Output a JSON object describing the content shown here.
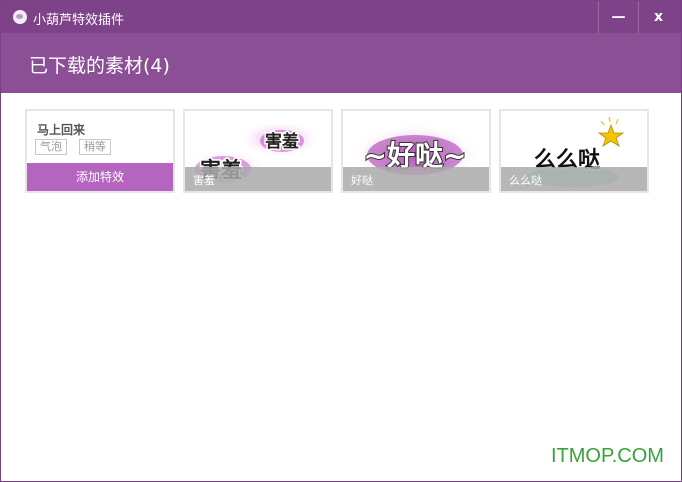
{
  "window": {
    "title": "小葫芦特效插件",
    "minimize_glyph": "—",
    "close_glyph": "x"
  },
  "header": {
    "title": "已下载的素材(4)"
  },
  "cards": [
    {
      "name": "马上回来",
      "tags": [
        "气泡",
        "稍等"
      ],
      "button_label": "添加特效"
    },
    {
      "label": "害羞",
      "art_text": [
        "害羞",
        "害羞"
      ]
    },
    {
      "label": "好哒",
      "art_text": "~好哒~"
    },
    {
      "label": "么么哒",
      "art_text": "么么哒"
    }
  ],
  "watermark": "ITMOP.COM",
  "colors": {
    "titlebar": "#7e4289",
    "header": "#8a4f95",
    "accent_button": "#b565c0",
    "label_bar": "#aaaaaa"
  }
}
